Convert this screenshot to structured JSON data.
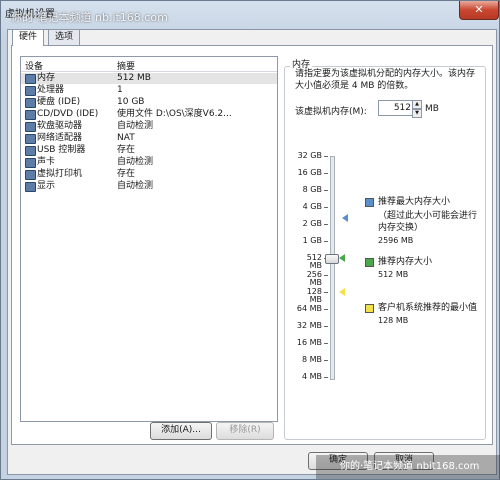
{
  "window": {
    "title": "虚拟机设置",
    "close_glyph": "✕"
  },
  "watermark": {
    "top": "你的·笔记本频道 nb.it168.com",
    "bottom": "你的·笔记本频道 nbit168.com"
  },
  "tabs": [
    {
      "label": "硬件"
    },
    {
      "label": "选项"
    }
  ],
  "device_list": {
    "headers": {
      "device": "设备",
      "summary": "摘要"
    },
    "rows": [
      {
        "name": "内存",
        "summary": "512 MB",
        "icon": "memory-icon"
      },
      {
        "name": "处理器",
        "summary": "1",
        "icon": "processor-icon"
      },
      {
        "name": "硬盘 (IDE)",
        "summary": "10 GB",
        "icon": "hard-disk-icon"
      },
      {
        "name": "CD/DVD (IDE)",
        "summary": "使用文件 D:\\OS\\深度V6.2...",
        "icon": "cdrom-icon"
      },
      {
        "name": "软盘驱动器",
        "summary": "自动检测",
        "icon": "floppy-icon"
      },
      {
        "name": "网络适配器",
        "summary": "NAT",
        "icon": "network-icon"
      },
      {
        "name": "USB 控制器",
        "summary": "存在",
        "icon": "usb-icon"
      },
      {
        "name": "声卡",
        "summary": "自动检测",
        "icon": "sound-icon"
      },
      {
        "name": "虚拟打印机",
        "summary": "存在",
        "icon": "printer-icon"
      },
      {
        "name": "显示",
        "summary": "自动检测",
        "icon": "display-icon"
      }
    ]
  },
  "buttons": {
    "add": "添加(A)...",
    "remove": "移除(R)",
    "ok": "确定",
    "cancel": "取消"
  },
  "memory": {
    "group_title": "内存",
    "description": "请指定要为该虚拟机分配的内存大小。该内存大小值必须是 4 MB 的倍数。",
    "label": "该虚拟机内存(M):",
    "value": "512",
    "unit": "MB",
    "scale_labels": [
      "32 GB",
      "16 GB",
      "8 GB",
      "4 GB",
      "2 GB",
      "1 GB",
      "512 MB",
      "256 MB",
      "128 MB",
      "64 MB",
      "32 MB",
      "16 MB",
      "8 MB",
      "4 MB"
    ],
    "current_value_mb": 512,
    "legend": [
      {
        "title": "推荐最大内存大小",
        "note": "（超过此大小可能会进行内存交换）",
        "value": "2596 MB",
        "color": "#5b8fc9",
        "marker_value_mb": 2596
      },
      {
        "title": "推荐内存大小",
        "value": "512 MB",
        "color": "#4aa84a",
        "marker_value_mb": 512
      },
      {
        "title": "客户机系统推荐的最小值",
        "value": "128 MB",
        "color": "#f2e14a",
        "marker_value_mb": 128
      }
    ]
  }
}
